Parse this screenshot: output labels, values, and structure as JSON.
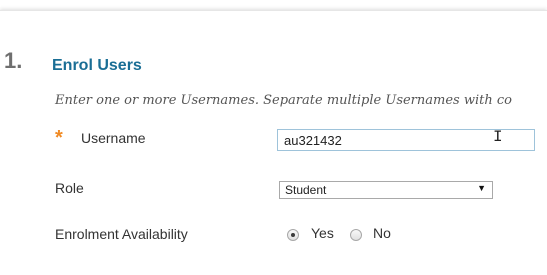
{
  "section": {
    "number": "1.",
    "title": "Enrol Users",
    "instructions": "Enter one or more Usernames. Separate multiple Usernames with co"
  },
  "fields": {
    "username": {
      "required_mark": "*",
      "label": "Username",
      "value": "au321432"
    },
    "role": {
      "label": "Role",
      "selected": "Student"
    },
    "availability": {
      "label": "Enrolment Availability",
      "options": [
        {
          "label": "Yes",
          "checked": true
        },
        {
          "label": "No",
          "checked": false
        }
      ]
    }
  },
  "colors": {
    "accent": "#1a6e95",
    "required": "#f08a24"
  },
  "icons": {
    "text_cursor": "text-cursor-icon",
    "dropdown": "chevron-down-icon"
  }
}
